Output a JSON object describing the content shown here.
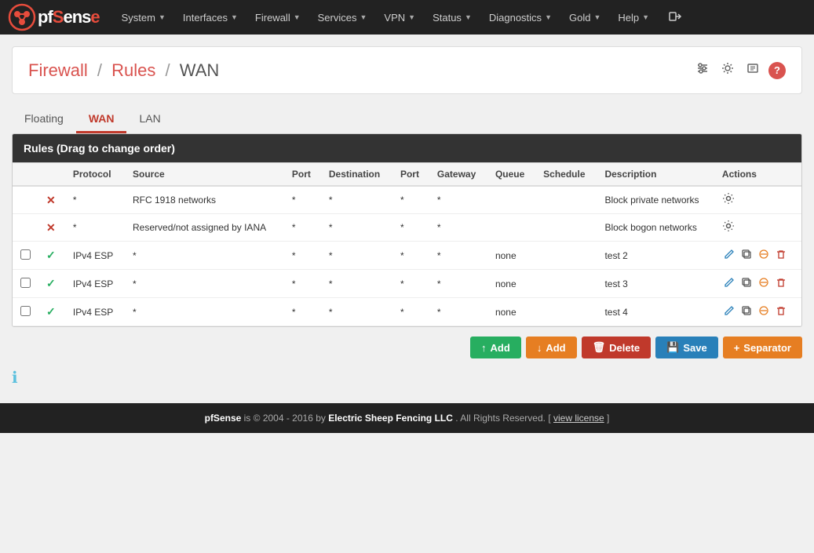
{
  "brand": {
    "name_part1": "Sense",
    "logo_alt": "pfSense logo"
  },
  "navbar": {
    "items": [
      {
        "label": "System",
        "has_caret": true
      },
      {
        "label": "Interfaces",
        "has_caret": true
      },
      {
        "label": "Firewall",
        "has_caret": true
      },
      {
        "label": "Services",
        "has_caret": true
      },
      {
        "label": "VPN",
        "has_caret": true
      },
      {
        "label": "Status",
        "has_caret": true
      },
      {
        "label": "Diagnostics",
        "has_caret": true
      },
      {
        "label": "Gold",
        "has_caret": true
      },
      {
        "label": "Help",
        "has_caret": true
      }
    ]
  },
  "breadcrumb": {
    "parts": [
      "Firewall",
      "Rules",
      "WAN"
    ],
    "separators": [
      "/",
      "/"
    ]
  },
  "header_icons": {
    "sliders": "⚙",
    "gear": "⚙",
    "list": "☰",
    "help": "?"
  },
  "tabs": [
    {
      "label": "Floating",
      "active": false
    },
    {
      "label": "WAN",
      "active": true
    },
    {
      "label": "LAN",
      "active": false
    }
  ],
  "table": {
    "title": "Rules (Drag to change order)",
    "columns": [
      "",
      "",
      "Protocol",
      "Source",
      "Port",
      "Destination",
      "Port",
      "Gateway",
      "Queue",
      "Schedule",
      "Description",
      "Actions"
    ],
    "rows": [
      {
        "enabled": false,
        "state_icon": "x",
        "check": false,
        "protocol": "*",
        "source": "RFC 1918 networks",
        "port": "*",
        "destination": "*",
        "dest_port": "*",
        "gateway": "*",
        "queue": "",
        "schedule": "",
        "description": "Block private networks",
        "has_gear": true
      },
      {
        "enabled": false,
        "state_icon": "x",
        "check": false,
        "protocol": "*",
        "source": "Reserved/not assigned by IANA",
        "port": "*",
        "destination": "*",
        "dest_port": "*",
        "gateway": "*",
        "queue": "",
        "schedule": "",
        "description": "Block bogon networks",
        "has_gear": true
      },
      {
        "enabled": true,
        "state_icon": "check",
        "check": false,
        "protocol": "IPv4 ESP",
        "source": "*",
        "port": "*",
        "destination": "*",
        "dest_port": "*",
        "gateway": "*",
        "queue": "none",
        "schedule": "",
        "description": "test 2",
        "has_gear": false
      },
      {
        "enabled": true,
        "state_icon": "check",
        "check": false,
        "protocol": "IPv4 ESP",
        "source": "*",
        "port": "*",
        "destination": "*",
        "dest_port": "*",
        "gateway": "*",
        "queue": "none",
        "schedule": "",
        "description": "test 3",
        "has_gear": false
      },
      {
        "enabled": true,
        "state_icon": "check",
        "check": false,
        "protocol": "IPv4 ESP",
        "source": "*",
        "port": "*",
        "destination": "*",
        "dest_port": "*",
        "gateway": "*",
        "queue": "none",
        "schedule": "",
        "description": "test 4",
        "has_gear": false
      }
    ]
  },
  "buttons": {
    "add_top": "Add",
    "add_bottom": "Add",
    "delete": "Delete",
    "save": "Save",
    "separator": "Separator"
  },
  "footer": {
    "text1": "pfSense",
    "text2": " is © 2004 - 2016 by ",
    "company": "Electric Sheep Fencing LLC",
    "text3": ". All Rights Reserved. [",
    "license_link": "view license",
    "text4": "]"
  }
}
